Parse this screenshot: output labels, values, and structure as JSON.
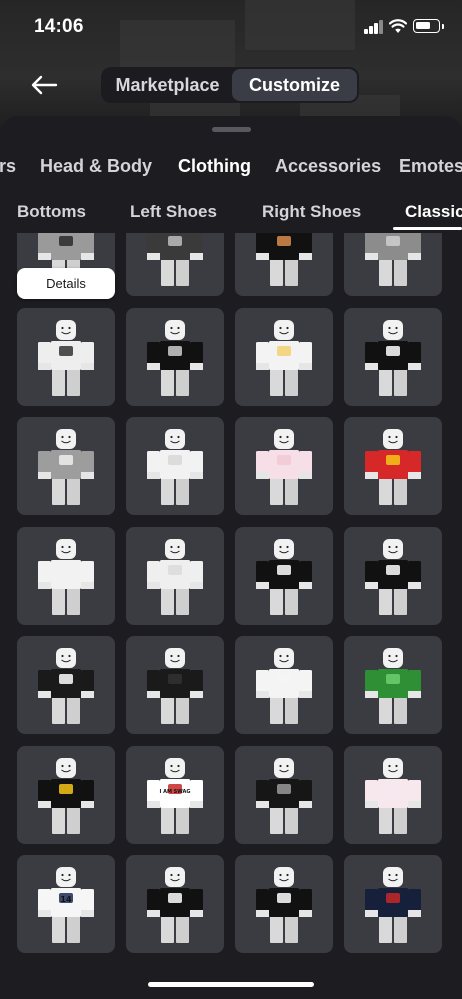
{
  "status": {
    "time": "14:06"
  },
  "header": {
    "back_icon": "arrow-left-icon",
    "segments": [
      {
        "label": "Marketplace",
        "selected": false
      },
      {
        "label": "Customize",
        "selected": true
      }
    ]
  },
  "category_tabs": [
    {
      "label": "rs",
      "active": false
    },
    {
      "label": "Head & Body",
      "active": false
    },
    {
      "label": "Clothing",
      "active": true
    },
    {
      "label": "Accessories",
      "active": false
    },
    {
      "label": "Emotes",
      "active": false
    }
  ],
  "subcategory_tabs": [
    {
      "label": "Bottoms",
      "active": false
    },
    {
      "label": "Left Shoes",
      "active": false
    },
    {
      "label": "Right Shoes",
      "active": false
    },
    {
      "label": "Classic",
      "active": true
    }
  ],
  "details_label": "Details",
  "items": [
    {
      "shirt": "#9a9a9a",
      "accent": "#2a2a2a",
      "text": ""
    },
    {
      "shirt": "#3a3a3a",
      "accent": "#bdbdbd",
      "text": ""
    },
    {
      "shirt": "#111111",
      "accent": "#d98d4a",
      "text": ""
    },
    {
      "shirt": "#8c8c8c",
      "accent": "#cfcfcf",
      "text": ""
    },
    {
      "shirt": "#eeeeee",
      "accent": "#333333",
      "text": ""
    },
    {
      "shirt": "#111111",
      "accent": "#cccccc",
      "text": ""
    },
    {
      "shirt": "#f3f3f3",
      "accent": "#f1d070",
      "text": ""
    },
    {
      "shirt": "#111111",
      "accent": "#ffffff",
      "text": ""
    },
    {
      "shirt": "#9d9d9d",
      "accent": "#eeeeee",
      "text": ""
    },
    {
      "shirt": "#f2f2f2",
      "accent": "#d8d8d8",
      "text": ""
    },
    {
      "shirt": "#f6dfe6",
      "accent": "#f2c9d6",
      "text": ""
    },
    {
      "shirt": "#d62828",
      "accent": "#f5c518",
      "text": ""
    },
    {
      "shirt": "#f2f2f2",
      "accent": "#f2f2f2",
      "text": ""
    },
    {
      "shirt": "#efefef",
      "accent": "#dadada",
      "text": ""
    },
    {
      "shirt": "#111111",
      "accent": "#ffffff",
      "text": ""
    },
    {
      "shirt": "#111111",
      "accent": "#ffffff",
      "text": ""
    },
    {
      "shirt": "#1a1a1a",
      "accent": "#ffffff",
      "text": ""
    },
    {
      "shirt": "#1a1a1a",
      "accent": "#333333",
      "text": ""
    },
    {
      "shirt": "#f4f4f4",
      "accent": "#f4f4f4",
      "text": ""
    },
    {
      "shirt": "#2f8f35",
      "accent": "#6bd06f",
      "text": ""
    },
    {
      "shirt": "#111111",
      "accent": "#f5c518",
      "text": ""
    },
    {
      "shirt": "#ffffff",
      "accent": "#c62828",
      "text": "I AM SWAG"
    },
    {
      "shirt": "#161616",
      "accent": "#9a9a9a",
      "text": ""
    },
    {
      "shirt": "#f7e8ee",
      "accent": "#f7e8ee",
      "text": ""
    },
    {
      "shirt": "#f6f6f6",
      "accent": "#1d2b55",
      "text": "14"
    },
    {
      "shirt": "#111111",
      "accent": "#ffffff",
      "text": ""
    },
    {
      "shirt": "#111111",
      "accent": "#ffffff",
      "text": ""
    },
    {
      "shirt": "#16203a",
      "accent": "#c62828",
      "text": ""
    }
  ]
}
